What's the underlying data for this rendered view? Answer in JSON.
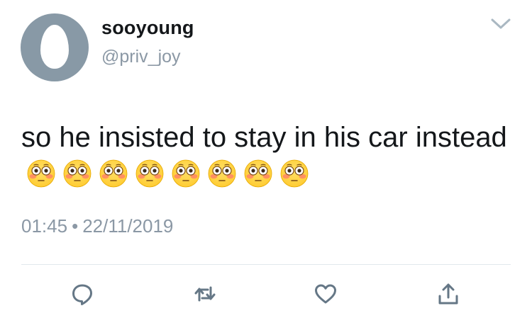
{
  "tweet": {
    "display_name": "sooyoung",
    "handle": "@priv_joy",
    "text": "so he insisted to stay in his car instead",
    "emoji_count": 8,
    "emoji_name": "flushed-face",
    "time": "01:45",
    "separator": "•",
    "date": "22/11/2019"
  },
  "icons": {
    "avatar": "default-egg-avatar",
    "menu": "chevron-down-icon",
    "reply": "reply-icon",
    "retweet": "retweet-icon",
    "like": "heart-icon",
    "share": "share-icon"
  },
  "colors": {
    "text": "#14171a",
    "secondary": "#8b98a5",
    "icon": "#657786",
    "avatar_bg": "#8899a6",
    "divider": "#e1e8ed",
    "emoji_face": "#ffcc33",
    "emoji_blush": "#ff7a6a"
  }
}
